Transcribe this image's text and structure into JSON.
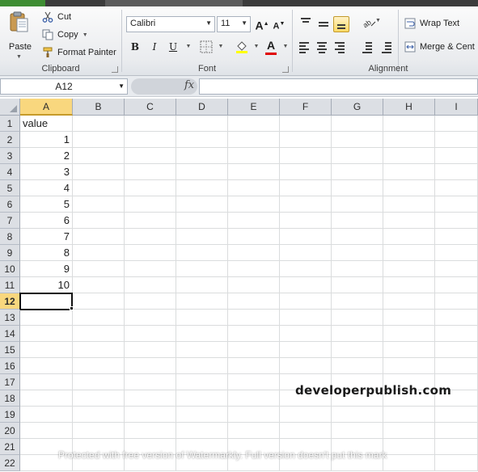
{
  "ribbon": {
    "clipboard": {
      "paste_label": "Paste",
      "cut_label": "Cut",
      "copy_label": "Copy",
      "format_painter_label": "Format Painter",
      "group_label": "Clipboard",
      "paste_icon": "clipboard-icon",
      "cut_icon": "scissors-icon",
      "copy_icon": "copy-icon",
      "format_painter_icon": "paintbrush-icon"
    },
    "font": {
      "font_name": "Calibri",
      "font_size": "11",
      "bold_label": "B",
      "italic_label": "I",
      "underline_label": "U",
      "grow_label": "A",
      "shrink_label": "A",
      "font_color_label": "A",
      "group_label": "Font",
      "fill_color": "#ffff00",
      "font_color": "#e00000"
    },
    "alignment": {
      "wrap_text_label": "Wrap Text",
      "merge_label": "Merge & Cent",
      "group_label": "Alignment"
    }
  },
  "formula_bar": {
    "name_box": "A12",
    "fx_label": "fx",
    "formula_value": ""
  },
  "sheet": {
    "columns": [
      "A",
      "B",
      "C",
      "D",
      "E",
      "F",
      "G",
      "H",
      "I"
    ],
    "rows": [
      "1",
      "2",
      "3",
      "4",
      "5",
      "6",
      "7",
      "8",
      "9",
      "10",
      "11",
      "12",
      "13",
      "14",
      "15",
      "16",
      "17",
      "18",
      "19",
      "20",
      "21",
      "22"
    ],
    "selected_column": "A",
    "selected_row": "12",
    "cells_A": [
      "value",
      "1",
      "2",
      "3",
      "4",
      "5",
      "6",
      "7",
      "8",
      "9",
      "10"
    ]
  },
  "watermark": {
    "site": "developerpublish.com",
    "notice": "Protected with free version of Watermarkly. Full version doesn't put this mark"
  },
  "colors": {
    "selection_header": "#f9d77e",
    "header_bg": "#dcdfe4",
    "gridline": "#dadcdd",
    "ribbon_accent": "#ffd966"
  }
}
